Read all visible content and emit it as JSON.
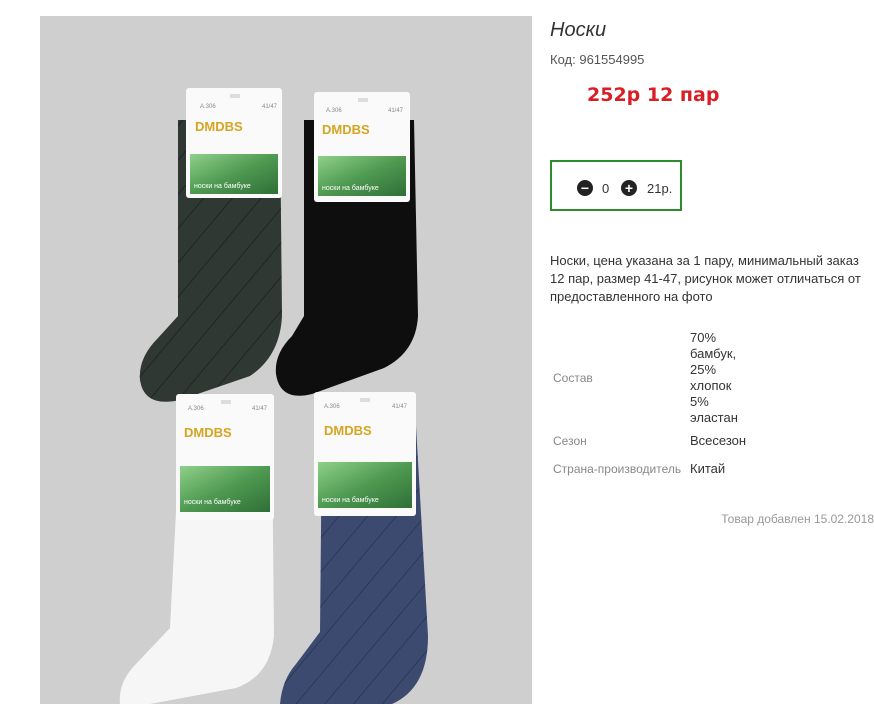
{
  "product": {
    "title": "Носки",
    "code_label": "Код:",
    "code_value": "961554995",
    "price_text": "252р 12 пар",
    "description": "Носки, цена указана за 1 пару, минимальный заказ 12 пар, размер 41-47, рисунок может отличаться от предоставленного на фото",
    "added_text": "Товар добавлен 15.02.2018"
  },
  "cart": {
    "minus_symbol": "−",
    "plus_symbol": "+",
    "quantity": "0",
    "unit_price": "21р."
  },
  "properties": [
    {
      "label": "Состав",
      "value_lines": [
        "70%",
        "бамбук,",
        "25%",
        "хлопок",
        "5%",
        "эластан"
      ]
    },
    {
      "label": "Сезон",
      "value_lines": [
        "Всесезон"
      ]
    },
    {
      "label": "Страна-производитель",
      "value_lines": [
        "Китай"
      ]
    }
  ],
  "photo": {
    "brand": "DMDBS",
    "article": "A.306",
    "size": "41/47",
    "label_text": "носки на бамбуке",
    "colors": {
      "background": "#cfcfcf",
      "sock_dark_green": "#2f3833",
      "sock_black": "#0e0e0e",
      "sock_white": "#f6f6f6",
      "sock_navy": "#3d4a70",
      "label_green": "#4f9a52",
      "brand_gold": "#d6a520"
    }
  }
}
